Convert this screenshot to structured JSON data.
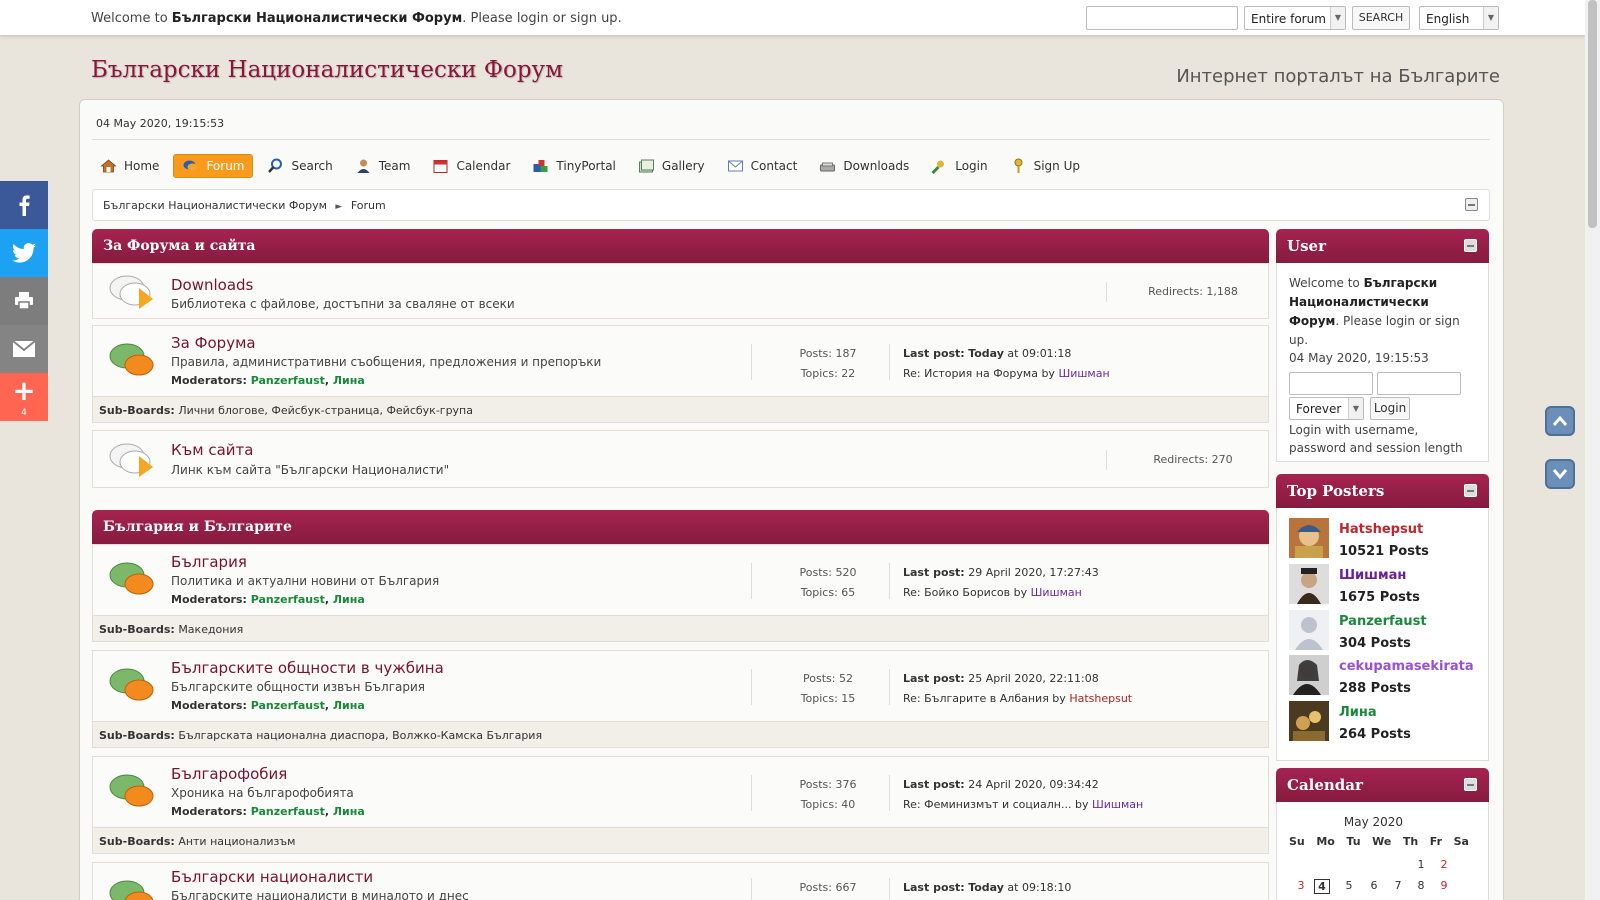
{
  "topbar": {
    "welcome_prefix": "Welcome to ",
    "welcome_forum": "Български Националистически Форум",
    "welcome_mid": ". Please ",
    "login": "login",
    "or": " or ",
    "signup": "sign up",
    "end": ".",
    "search_scope": "Entire forum",
    "search_button": "SEARCH",
    "language": "English"
  },
  "header": {
    "title": "Български Националистически Форум",
    "slogan": "Интернет порталът на Българите",
    "datetime": "04 May 2020, 19:15:53"
  },
  "menu": [
    {
      "label": "Home",
      "icon": "home-icon"
    },
    {
      "label": "Forum",
      "icon": "forum-icon"
    },
    {
      "label": "Search",
      "icon": "search-icon"
    },
    {
      "label": "Team",
      "icon": "team-icon"
    },
    {
      "label": "Calendar",
      "icon": "calendar-icon"
    },
    {
      "label": "TinyPortal",
      "icon": "tinyportal-icon"
    },
    {
      "label": "Gallery",
      "icon": "gallery-icon"
    },
    {
      "label": "Contact",
      "icon": "contact-icon"
    },
    {
      "label": "Downloads",
      "icon": "downloads-icon"
    },
    {
      "label": "Login",
      "icon": "login-icon"
    },
    {
      "label": "Sign Up",
      "icon": "signup-icon"
    }
  ],
  "breadcrumb": {
    "root": "Български Националистически Форум",
    "arrow": "►",
    "current": "Forum"
  },
  "categories": [
    {
      "title": "За Форума и сайта",
      "boards": [
        {
          "name": "Downloads",
          "desc": "Библиотека с файлове, достъпни за сваляне от всеки",
          "redirects": "Redirects: 1,188"
        },
        {
          "name": "За Форума",
          "desc": "Правила, административни съобщения, предложения и препоръки",
          "mods_label": "Moderators:",
          "mod1": "Panzerfaust",
          "mod2": "Лина",
          "posts": "Posts: 187",
          "topics": "Topics: 22",
          "last_label": "Last post:",
          "last_when": "Today",
          "last_time": " at 09:01:18",
          "last_topic": "Re: История на Форума",
          "by": " by ",
          "last_user": "Шишман",
          "sub_label": "Sub-Boards:",
          "subs": "Лични блогове, Фейсбук-страница, Фейсбук-група"
        },
        {
          "name": "Към сайта",
          "desc": "Линк към сайта \"Български Националисти\"",
          "redirects": "Redirects: 270"
        }
      ]
    },
    {
      "title": "България и Българите",
      "boards": [
        {
          "name": "България",
          "desc": "Политика и актуални новини от България",
          "mods_label": "Moderators:",
          "mod1": "Panzerfaust",
          "mod2": "Лина",
          "posts": "Posts: 520",
          "topics": "Topics: 65",
          "last_label": "Last post:",
          "last_time": " 29 April 2020, 17:27:43",
          "last_topic": "Re: Бойко Борисов",
          "by": " by ",
          "last_user": "Шишман",
          "sub_label": "Sub-Boards:",
          "subs": "Македония"
        },
        {
          "name": "Българските общности в чужбина",
          "desc": "Българските общности извън България",
          "mods_label": "Moderators:",
          "mod1": "Panzerfaust",
          "mod2": "Лина",
          "posts": "Posts: 52",
          "topics": "Topics: 15",
          "last_label": "Last post:",
          "last_time": " 25 April 2020, 22:11:08",
          "last_topic": "Re: Българите в Албания",
          "by": " by ",
          "last_user": "Hatshepsut",
          "sub_label": "Sub-Boards:",
          "subs": "Българската национална диаспора, Волжко-Камска България"
        },
        {
          "name": "Българофобия",
          "desc": "Хроника на българофобията",
          "mods_label": "Moderators:",
          "mod1": "Panzerfaust",
          "mod2": "Лина",
          "posts": "Posts: 376",
          "topics": "Topics: 40",
          "last_label": "Last post:",
          "last_time": " 24 April 2020, 09:34:42",
          "last_topic": "Re: Феминизмът и социалн...",
          "by": " by ",
          "last_user": "Шишман",
          "sub_label": "Sub-Boards:",
          "subs": "Анти национализъм"
        },
        {
          "name": "Български националисти",
          "desc": "Българските националисти в миналото и днес",
          "posts": "Posts: 667",
          "last_label": "Last post:",
          "last_when": "Today",
          "last_time": " at 09:18:10"
        }
      ]
    }
  ],
  "sidebar": {
    "user": {
      "title": "User",
      "welcome_prefix": "Welcome to ",
      "welcome_forum": "Български Националистически Форум",
      "welcome_mid": ". Please ",
      "login": "login",
      "or": " or ",
      "signup": "sign up",
      "end": ".",
      "datetime": "04 May 2020, 19:15:53",
      "session": "Forever",
      "login_button": "Login",
      "hint": "Login with username, password and session length"
    },
    "top_posters": {
      "title": "Top Posters",
      "items": [
        {
          "name": "Hatshepsut",
          "posts": "10521 Posts",
          "color": "#c0272d"
        },
        {
          "name": "Шишман",
          "posts": "1675 Posts",
          "color": "#6a1fa3"
        },
        {
          "name": "Panzerfaust",
          "posts": "304 Posts",
          "color": "#1a8a3a"
        },
        {
          "name": "cekupamasekirata",
          "posts": "288 Posts",
          "color": "#9a4fd8"
        },
        {
          "name": "Лина",
          "posts": "264 Posts",
          "color": "#1a8a3a"
        }
      ]
    },
    "calendar": {
      "title": "Calendar",
      "month": "May 2020",
      "days": [
        "Su",
        "Mo",
        "Tu",
        "We",
        "Th",
        "Fr",
        "Sa"
      ],
      "row1": [
        "",
        "",
        "",
        "",
        "",
        "1",
        "2"
      ],
      "row2": [
        "3",
        "4",
        "5",
        "6",
        "7",
        "8",
        "9"
      ]
    }
  },
  "social": {
    "share_count": "4"
  },
  "colors": {
    "accent": "#8a1538",
    "active_menu": "#f89a1c"
  }
}
